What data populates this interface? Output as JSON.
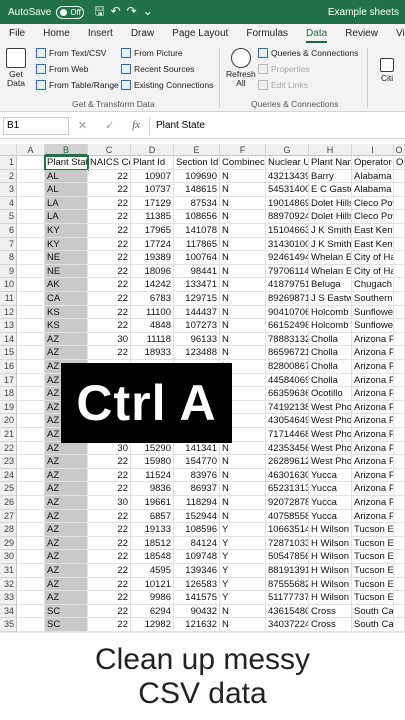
{
  "titlebar": {
    "autosave_label": "AutoSave",
    "toggle_label": "Off",
    "filename": "Example sheets"
  },
  "tabs": [
    "File",
    "Home",
    "Insert",
    "Draw",
    "Page Layout",
    "Formulas",
    "Data",
    "Review",
    "View"
  ],
  "active_tab": "Data",
  "ribbon": {
    "get_data_label_1": "Get",
    "get_data_label_2": "Data",
    "from_text_csv": "From Text/CSV",
    "from_web": "From Web",
    "from_table_range": "From Table/Range",
    "from_picture": "From Picture",
    "recent_sources": "Recent Sources",
    "existing_connections": "Existing Connections",
    "group1_label": "Get & Transform Data",
    "refresh_label_1": "Refresh",
    "refresh_label_2": "All",
    "queries_connections": "Queries & Connections",
    "properties": "Properties",
    "edit_links": "Edit Links",
    "group2_label": "Queries & Connections",
    "cities_label": "Citi"
  },
  "formulabar": {
    "namebox": "B1",
    "fx": "fx",
    "content": "Plant State"
  },
  "columns": [
    "A",
    "B",
    "C",
    "D",
    "E",
    "F",
    "G",
    "H",
    "I",
    "O"
  ],
  "header_row": [
    "",
    "Plant Stat",
    "NAICS Coc",
    "Plant Id",
    "Section Id",
    "Combinec",
    "Nuclear U",
    "Plant Nan",
    "Operator",
    "O"
  ],
  "rows": [
    [
      "AL",
      "22",
      "10907",
      "109690",
      "N",
      "43213439",
      "Barry",
      "Alabama P"
    ],
    [
      "AL",
      "22",
      "10737",
      "148615",
      "N",
      "54531400",
      "E C Gastor",
      "Alabama P"
    ],
    [
      "LA",
      "22",
      "17129",
      "87534",
      "N",
      "19014869",
      "Dolet Hills",
      "Cleco Pow"
    ],
    [
      "LA",
      "22",
      "11385",
      "108656",
      "N",
      "88970924",
      "Dolet Hills",
      "Cleco Pow"
    ],
    [
      "KY",
      "22",
      "17965",
      "141078",
      "N",
      "15104663",
      "J K Smith",
      "East Kentu"
    ],
    [
      "KY",
      "22",
      "17724",
      "117865",
      "N",
      "31430100",
      "J K Smith",
      "East Kentu"
    ],
    [
      "NE",
      "22",
      "19389",
      "100764",
      "N",
      "92461494",
      "Whelan E",
      "City of Ha"
    ],
    [
      "NE",
      "22",
      "18096",
      "98441",
      "N",
      "79706114",
      "Whelan E",
      "City of Ha"
    ],
    [
      "AK",
      "22",
      "14242",
      "133471",
      "N",
      "41879751",
      "Beluga",
      "Chugach E"
    ],
    [
      "CA",
      "22",
      "6783",
      "129715",
      "N",
      "89269871",
      "J S Eastwo",
      "Southern"
    ],
    [
      "KS",
      "22",
      "11100",
      "144437",
      "N",
      "90410706",
      "Holcomb",
      "Sunflower"
    ],
    [
      "KS",
      "22",
      "4848",
      "107273",
      "N",
      "66152498",
      "Holcomb",
      "Sunflower"
    ],
    [
      "AZ",
      "30",
      "11118",
      "96133",
      "N",
      "78883132",
      "Cholla",
      "Arizona Pu"
    ],
    [
      "AZ",
      "22",
      "18933",
      "123488",
      "N",
      "86596721",
      "Cholla",
      "Arizona Pu"
    ],
    [
      "AZ",
      "",
      "",
      "",
      "N",
      "82800867",
      "Cholla",
      "Arizona Pu"
    ],
    [
      "AZ",
      "",
      "",
      "",
      "N",
      "44584069",
      "Cholla",
      "Arizona Pu"
    ],
    [
      "AZ",
      "",
      "",
      "",
      "N",
      "66359636",
      "Ocotillo",
      "Arizona Pu"
    ],
    [
      "AZ",
      "",
      "",
      "",
      "N",
      "74192138",
      "West Pho",
      "Arizona Pu"
    ],
    [
      "AZ",
      "",
      "",
      "",
      "N",
      "43054649",
      "West Pho",
      "Arizona Pu"
    ],
    [
      "AZ",
      "",
      "",
      "",
      "N",
      "71714468",
      "West Pho",
      "Arizona Pu"
    ],
    [
      "AZ",
      "30",
      "15290",
      "141341",
      "N",
      "42353456",
      "West Pho",
      "Arizona Pu"
    ],
    [
      "AZ",
      "22",
      "15980",
      "154770",
      "N",
      "26289612",
      "West Pho",
      "Arizona Pu"
    ],
    [
      "AZ",
      "22",
      "11524",
      "83976",
      "N",
      "46301630",
      "Yucca",
      "Arizona Pu"
    ],
    [
      "AZ",
      "22",
      "9836",
      "86937",
      "N",
      "65231313",
      "Yucca",
      "Arizona Pu"
    ],
    [
      "AZ",
      "30",
      "19661",
      "118294",
      "N",
      "92072878",
      "Yucca",
      "Arizona Pu"
    ],
    [
      "AZ",
      "22",
      "6857",
      "152944",
      "N",
      "40758558",
      "Yucca",
      "Arizona Pu"
    ],
    [
      "AZ",
      "22",
      "19133",
      "108596",
      "Y",
      "10663514",
      "H Wilson S",
      "Tucson Ele"
    ],
    [
      "AZ",
      "22",
      "18512",
      "84124",
      "Y",
      "72871033",
      "H Wilson S",
      "Tucson Ele"
    ],
    [
      "AZ",
      "22",
      "18548",
      "109748",
      "Y",
      "50547856",
      "H Wilson S",
      "Tucson Ele"
    ],
    [
      "AZ",
      "22",
      "4595",
      "139346",
      "Y",
      "88191391",
      "H Wilson S",
      "Tucson Ele"
    ],
    [
      "AZ",
      "22",
      "10121",
      "126583",
      "Y",
      "87555682",
      "H Wilson S",
      "Tucson Ele"
    ],
    [
      "AZ",
      "22",
      "9986",
      "141575",
      "Y",
      "51177737",
      "H Wilson S",
      "Tucson Ele"
    ],
    [
      "SC",
      "22",
      "6294",
      "90432",
      "N",
      "43615480",
      "Cross",
      "South Car"
    ],
    [
      "SC",
      "22",
      "12982",
      "121632",
      "N",
      "34037224",
      "Cross",
      "South Car"
    ]
  ],
  "overlay_text": "Ctrl A",
  "caption": {
    "line1": "Clean up messy",
    "line2": "CSV data"
  }
}
